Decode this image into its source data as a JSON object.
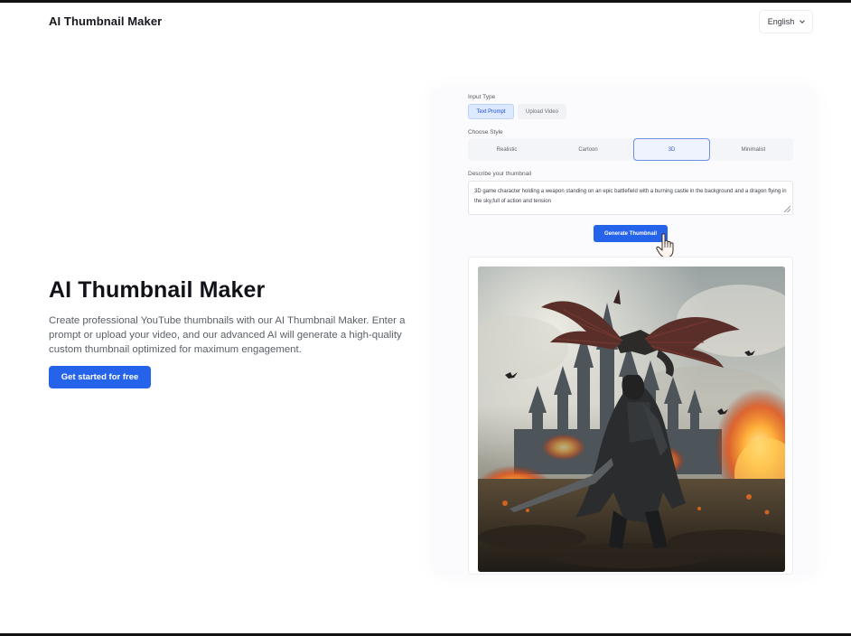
{
  "header": {
    "brand": "AI Thumbnail Maker",
    "language": "English"
  },
  "hero": {
    "title": "AI Thumbnail Maker",
    "description": "Create professional YouTube thumbnails with our AI Thumbnail Maker. Enter a prompt or upload your video, and our advanced AI will generate a high-quality custom thumbnail optimized for maximum engagement.",
    "cta_label": "Get started for free"
  },
  "form": {
    "input_type_label": "Input Type",
    "input_types": [
      {
        "label": "Text Prompt",
        "active": true
      },
      {
        "label": "Upload Video",
        "active": false
      }
    ],
    "style_label": "Choose Style",
    "styles": [
      {
        "label": "Realistic",
        "active": false
      },
      {
        "label": "Cartoon",
        "active": false
      },
      {
        "label": "3D",
        "active": true
      },
      {
        "label": "Minimalist",
        "active": false
      }
    ],
    "describe_label": "Describe your thumbnail",
    "prompt_value": "3D game character holding a weapon standing on an epic battlefield with a burning castle in the background and a dragon flying in the sky,full of action and tension",
    "generate_label": "Generate Thumbnail"
  },
  "result": {
    "image_subject": "dragon-castle-warrior-thumbnail"
  },
  "colors": {
    "accent": "#2563eb",
    "active_pill_bg": "#dde9fe",
    "text_dark": "#101217"
  }
}
